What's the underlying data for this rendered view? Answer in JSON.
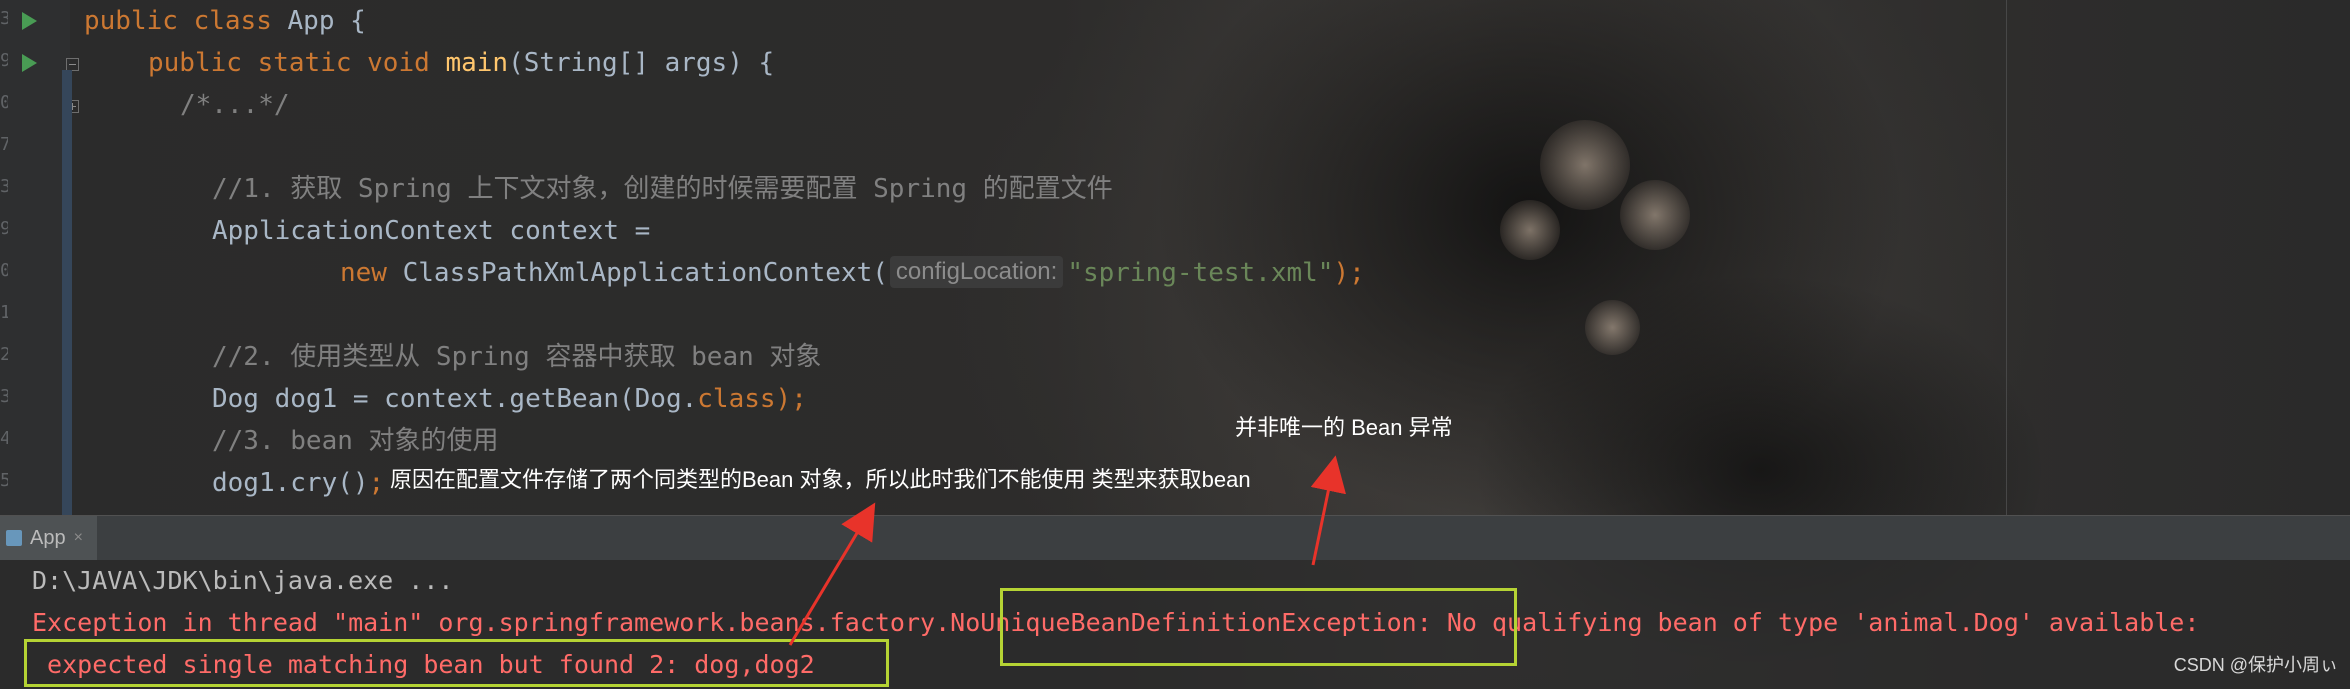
{
  "editor": {
    "gutter_numbers": [
      "3",
      "9",
      "0",
      "7",
      "3",
      "9",
      "0",
      "1",
      "2",
      "3",
      "4",
      "5"
    ],
    "lines": {
      "l1": {
        "kw1": "public",
        "kw2": "class",
        "rest": " App {"
      },
      "l2": {
        "kw1": "public",
        "kw2": "static",
        "kw3": "void",
        "fn": "main",
        "rest": "(String[] args) {"
      },
      "l3": {
        "text": "/*...*/"
      },
      "l4": {
        "comment": "//1. 获取 Spring 上下文对象，创建的时候需要配置 Spring 的配置文件"
      },
      "l5": {
        "text": "ApplicationContext context ="
      },
      "l6": {
        "kw": "new",
        "text": " ClassPathXmlApplicationContext(",
        "hint": "configLocation:",
        "str": "\"spring-test.xml\"",
        "end": ");"
      },
      "l7": {
        "comment": "//2. 使用类型从 Spring 容器中获取 bean 对象"
      },
      "l8": {
        "text": "Dog dog1 = context.getBean(Dog.",
        "kw": "class",
        "end": ");"
      },
      "l9": {
        "comment": "//3. bean 对象的使用"
      },
      "l10": {
        "text": "dog1.cry()",
        "end": ";"
      }
    }
  },
  "annotations": {
    "note1": "并非唯一的 Bean 异常",
    "note2": "原因在配置文件存储了两个同类型的Bean 对象，所以此时我们不能使用 类型来获取bean"
  },
  "run_window": {
    "tab_label": "App",
    "tab_close": "×",
    "console": {
      "line1": "D:\\JAVA\\JDK\\bin\\java.exe ...",
      "line2a": "Exception in thread \"main\" org.springframework.beans.factory.",
      "line2b": "NoUniqueBeanDefinitionException",
      "line2c": ": No qualifying bean of type 'animal.Dog' available:",
      "line3": " expected single matching bean but found 2: dog,dog2"
    }
  },
  "watermark": "CSDN @保护小周ぃ",
  "colors": {
    "keyword": "#cc7832",
    "function": "#ffc66d",
    "comment": "#808080",
    "string": "#6a8759",
    "error": "#ff6b68",
    "highlight_box": "#b5d334",
    "arrow": "#e8332a",
    "run_icon": "#499c54"
  }
}
